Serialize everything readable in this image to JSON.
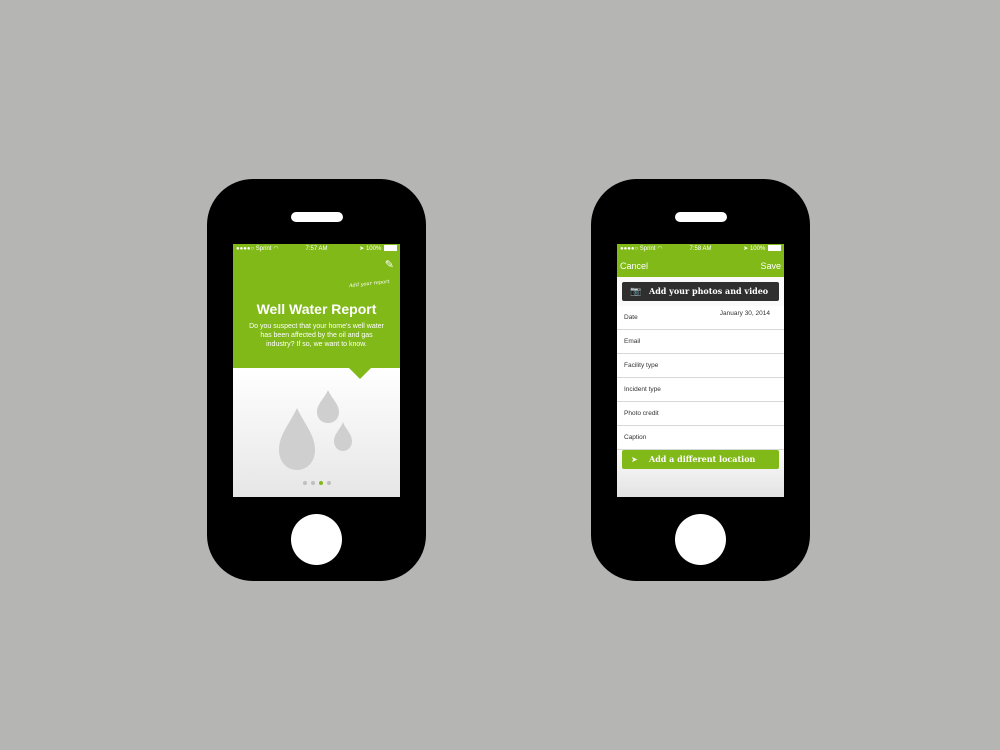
{
  "colors": {
    "background": "#b5b5b3",
    "phone_body": "#000000",
    "accent": "#80b918",
    "dark_button": "#2f2f2f"
  },
  "left_phone": {
    "status": {
      "signal": "●●●●○",
      "carrier": "Sprint",
      "wifi": "wifi-icon",
      "time": "7:57 AM",
      "battery": "100%"
    },
    "add_report_label": "Add your report",
    "title": "Well Water Report",
    "description": "Do you suspect that your home's well water has been affected by the oil and gas industry? If so, we want to know.",
    "page_indicator": {
      "total": 4,
      "active_index": 2
    }
  },
  "right_phone": {
    "status": {
      "signal": "●●●●○",
      "carrier": "Sprint",
      "wifi": "wifi-icon",
      "time": "7:58 AM",
      "battery": "100%"
    },
    "nav": {
      "cancel": "Cancel",
      "save": "Save"
    },
    "media_button": "Add your photos and video",
    "fields": [
      {
        "label": "Date",
        "value": "January 30, 2014"
      },
      {
        "label": "Email",
        "value": ""
      },
      {
        "label": "Facility type",
        "value": ""
      },
      {
        "label": "Incident type",
        "value": ""
      },
      {
        "label": "Photo credit",
        "value": ""
      },
      {
        "label": "Caption",
        "value": ""
      }
    ],
    "location_button": "Add a different location"
  }
}
